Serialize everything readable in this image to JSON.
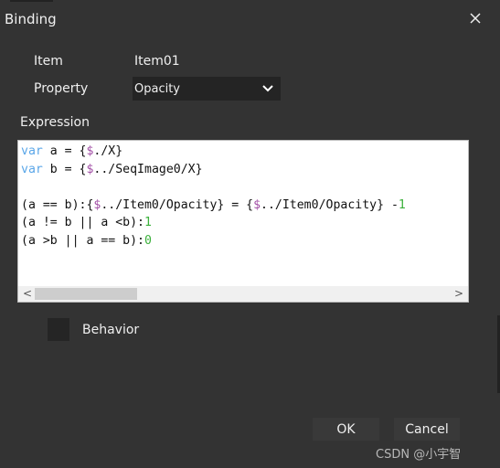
{
  "dialog": {
    "title": "Binding",
    "close_icon": "close-icon"
  },
  "fields": {
    "item_label": "Item",
    "item_value": "Item01",
    "property_label": "Property",
    "property_value": "Opacity"
  },
  "expression": {
    "label": "Expression",
    "colors": {
      "keyword": "#5aa6e8",
      "sigil": "#a24fa6",
      "number": "#3bb03b",
      "text": "#111111"
    },
    "lines": [
      {
        "tokens": [
          {
            "type": "keyword",
            "text": "var"
          },
          {
            "type": "text",
            "text": " a = {"
          },
          {
            "type": "sigil",
            "text": "$"
          },
          {
            "type": "text",
            "text": "./X}"
          }
        ]
      },
      {
        "tokens": [
          {
            "type": "keyword",
            "text": "var"
          },
          {
            "type": "text",
            "text": " b = {"
          },
          {
            "type": "sigil",
            "text": "$"
          },
          {
            "type": "text",
            "text": "../SeqImage0/X}"
          }
        ]
      },
      {
        "tokens": []
      },
      {
        "tokens": [
          {
            "type": "text",
            "text": "(a == b):{"
          },
          {
            "type": "sigil",
            "text": "$"
          },
          {
            "type": "text",
            "text": "../Item0/Opacity} = {"
          },
          {
            "type": "sigil",
            "text": "$"
          },
          {
            "type": "text",
            "text": "../Item0/Opacity} -"
          },
          {
            "type": "number",
            "text": "1"
          }
        ]
      },
      {
        "tokens": [
          {
            "type": "text",
            "text": "(a != b || a <b):"
          },
          {
            "type": "number",
            "text": "1"
          }
        ]
      },
      {
        "tokens": [
          {
            "type": "text",
            "text": "(a >b || a == b):"
          },
          {
            "type": "number",
            "text": "0"
          }
        ]
      }
    ],
    "scroll_left": "<",
    "scroll_right": ">"
  },
  "behavior": {
    "label": "Behavior",
    "checked": false
  },
  "buttons": {
    "ok": "OK",
    "cancel": "Cancel"
  },
  "watermark": "CSDN @小宇智"
}
